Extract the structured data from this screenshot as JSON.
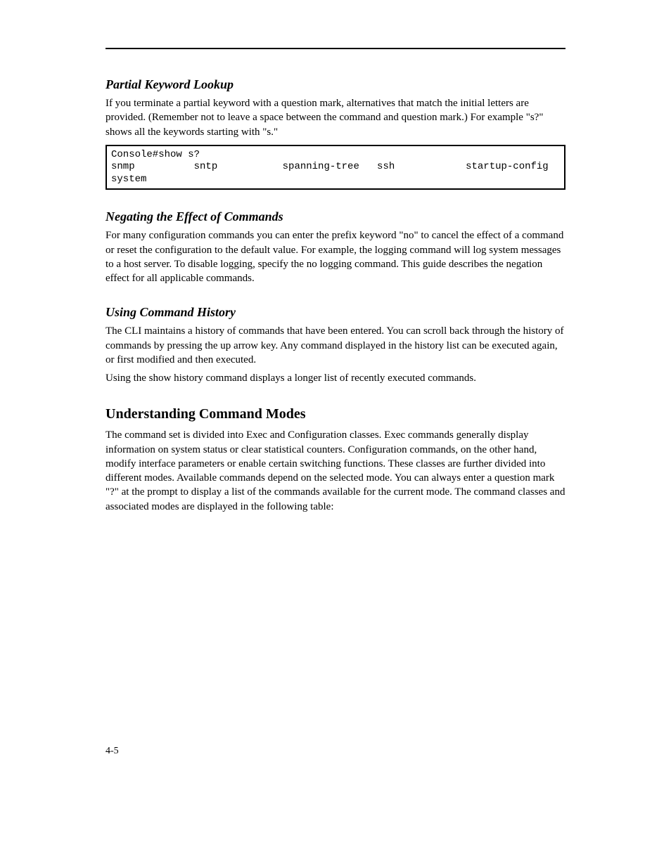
{
  "header": {
    "rule": true
  },
  "sections": {
    "partial_help": {
      "title": "Partial Keyword Lookup",
      "p1": "If you terminate a partial keyword with a question mark, alternatives that match the initial letters are provided. (Remember not to leave a space between the command and question mark.) For example \"s?\" shows all the keywords starting with \"s.\""
    },
    "code": {
      "line1": "Console#show s?",
      "line2": "snmp          sntp           spanning-tree   ssh            startup-config",
      "line3": "system"
    },
    "negating": {
      "title": "Negating the Effect of Commands",
      "p1": "For many configuration commands you can enter the prefix keyword \"no\" to cancel the effect of a command or reset the configuration to the default value. For example, the logging command will log system messages to a host server. To disable logging, specify the no logging command. This guide describes the negation effect for all applicable commands."
    },
    "history": {
      "title": "Using Command History",
      "p1": "The CLI maintains a history of commands that have been entered. You can scroll back through the history of commands by pressing the up arrow key. Any command displayed in the history list can be executed again, or first modified and then executed.",
      "p2": "Using the show history command displays a longer list of recently executed commands."
    },
    "modes": {
      "title": "Understanding Command Modes",
      "p1": "The command set is divided into Exec and Configuration classes. Exec commands generally display information on system status or clear statistical counters. Configuration commands, on the other hand, modify interface parameters or enable certain switching functions. These classes are further divided into different modes. Available commands depend on the selected mode. You can always enter a question mark \"?\" at the prompt to display a list of the commands available for the current mode. The command classes and associated modes are displayed in the following table:"
    }
  },
  "footer": {
    "page": "4-5"
  }
}
